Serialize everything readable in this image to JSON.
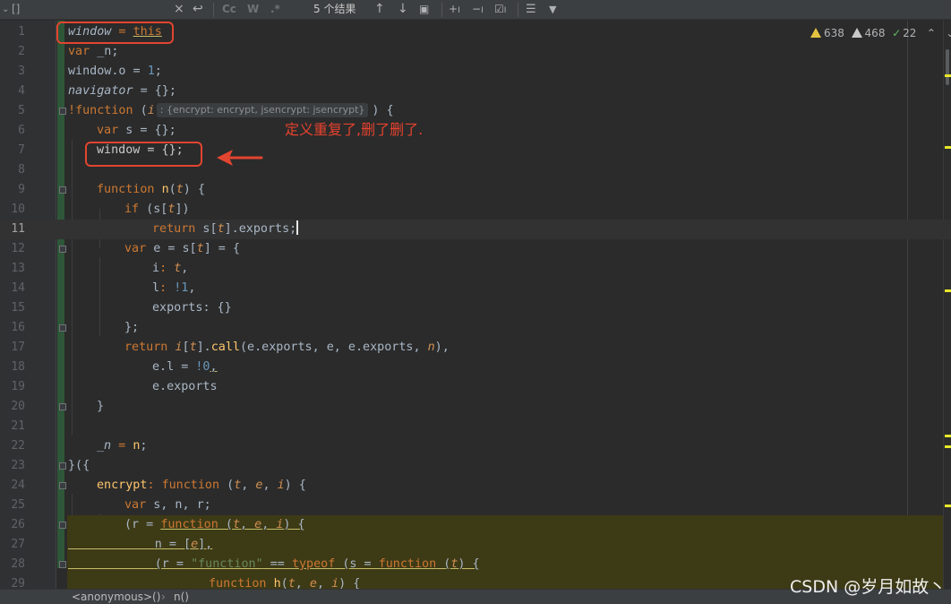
{
  "toolbar": {
    "left_icons": [
      "chevron-down",
      "brackets"
    ],
    "clear_icon": "×",
    "undo_icon": "↩",
    "match_case": "Cc",
    "words": "W",
    "regex": ".*",
    "result_count": "5 个结果",
    "prev_icon": "↑",
    "next_icon": "↓",
    "select_icon": "▣",
    "filter_icon": "▼"
  },
  "inspections": {
    "warnings": "638",
    "weak_warnings": "468",
    "typos": "22",
    "up": "⌃",
    "down": "⌄"
  },
  "hint": ": {encrypt: encrypt, jsencrypt: jsencrypt}",
  "lines": [
    "1",
    "2",
    "3",
    "4",
    "5",
    "6",
    "7",
    "8",
    "9",
    "10",
    "11",
    "12",
    "13",
    "14",
    "15",
    "16",
    "17",
    "18",
    "19",
    "20",
    "21",
    "22",
    "23",
    "24",
    "25",
    "26",
    "27",
    "28",
    "29"
  ],
  "code": {
    "l1": [
      "window",
      " = ",
      "this"
    ],
    "l2": [
      "var",
      " _n;"
    ],
    "l3": [
      "window.o = ",
      "1",
      ";"
    ],
    "l4": [
      "navigator",
      " = {};"
    ],
    "l5": [
      "!",
      "function",
      " (",
      "i",
      ") {"
    ],
    "l6": [
      "var",
      " s = {};"
    ],
    "l7": [
      "window = {};"
    ],
    "l9": [
      "function",
      " ",
      "n",
      "(",
      "t",
      ") {"
    ],
    "l10": [
      "if",
      " (s[",
      "t",
      "])"
    ],
    "l11": [
      "return",
      " s[",
      "t",
      "].exports;"
    ],
    "l12": [
      "var",
      " e = s[",
      "t",
      "] = {"
    ],
    "l13": [
      "i",
      ": ",
      "t",
      ","
    ],
    "l14": [
      "l",
      ": ",
      "!1",
      ","
    ],
    "l15": [
      "exports",
      ": {}"
    ],
    "l16": [
      "};"
    ],
    "l17": [
      "return",
      " ",
      "i",
      "[",
      "t",
      "].",
      "call",
      "(e.exports, e, e.exports, ",
      "n",
      "),"
    ],
    "l18": [
      "e.l = ",
      "!0",
      ","
    ],
    "l19": [
      "e.exports"
    ],
    "l20": [
      "}"
    ],
    "l22": [
      "_n",
      " = ",
      "n",
      ";"
    ],
    "l23": [
      "}({"
    ],
    "l24": [
      "encrypt",
      ": ",
      "function",
      " (",
      "t",
      ", ",
      "e",
      ", ",
      "i",
      ") {"
    ],
    "l25": [
      "var",
      " s, n, r;"
    ],
    "l26": [
      "(r = ",
      "function",
      " (",
      "t",
      ", ",
      "e",
      ", ",
      "i",
      ") {"
    ],
    "l27": [
      "n = [",
      "e",
      "],"
    ],
    "l28": [
      "(r = ",
      "\"function\"",
      " == ",
      "typeof",
      " (s = ",
      "function",
      " (",
      "t",
      ") {"
    ],
    "l29": [
      "function",
      " ",
      "h",
      "(",
      "t",
      ", ",
      "e",
      ", ",
      "i",
      ") {"
    ]
  },
  "annotation": "定义重复了,删了删了.",
  "breadcrumb": [
    "<anonymous>()",
    "›",
    "n()"
  ],
  "watermark": "CSDN @岁月如故丶",
  "colors": {
    "keyword": "#cc7832",
    "number": "#6897bb",
    "string": "#6a8759",
    "function_name": "#ffc66d",
    "parameter": "#d18f52",
    "annotation": "#e2452f"
  }
}
